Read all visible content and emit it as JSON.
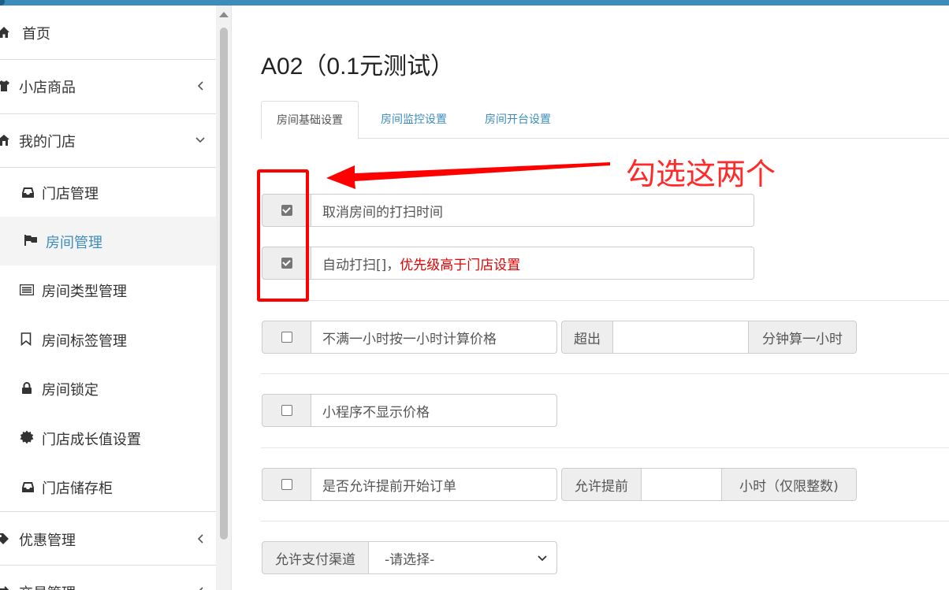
{
  "sidebar": {
    "home": "首页",
    "shop_goods": "小店商品",
    "my_store": "我的门店",
    "store_manage": "门店管理",
    "room_manage": "房间管理",
    "room_type_manage": "房间类型管理",
    "room_tag_manage": "房间标签管理",
    "room_lock": "房间锁定",
    "store_growth": "门店成长值设置",
    "store_locker": "门店储存柜",
    "promo_manage": "优惠管理",
    "trade_manage": "交易管理"
  },
  "main": {
    "title": "A02（0.1元测试）",
    "tabs": [
      "房间基础设置",
      "房间监控设置",
      "房间开台设置"
    ],
    "options": {
      "cancel_cleaning": "取消房间的打扫时间",
      "auto_clean_prefix": "自动打扫[]，",
      "auto_clean_note": "优先级高于门店设置",
      "hour_rounding": "不满一小时按一小时计算价格",
      "exceed_label": "超出",
      "minutes_suffix": "分钟算一小时",
      "hide_price": "小程序不显示价格",
      "allow_early": "是否允许提前开始订单",
      "allow_early_label": "允许提前",
      "hours_suffix": "小时（仅限整数)",
      "payment_label": "允许支付渠道",
      "payment_select": "-请选择-"
    },
    "checked": {
      "cancel_cleaning": true,
      "auto_clean": true,
      "hour_rounding": false,
      "hide_price": false,
      "allow_early": false
    }
  },
  "annotation": {
    "text": "勾选这两个",
    "color": "#ff0000"
  },
  "colors": {
    "accent": "#3c8dbc",
    "annotation": "#ff0000"
  }
}
